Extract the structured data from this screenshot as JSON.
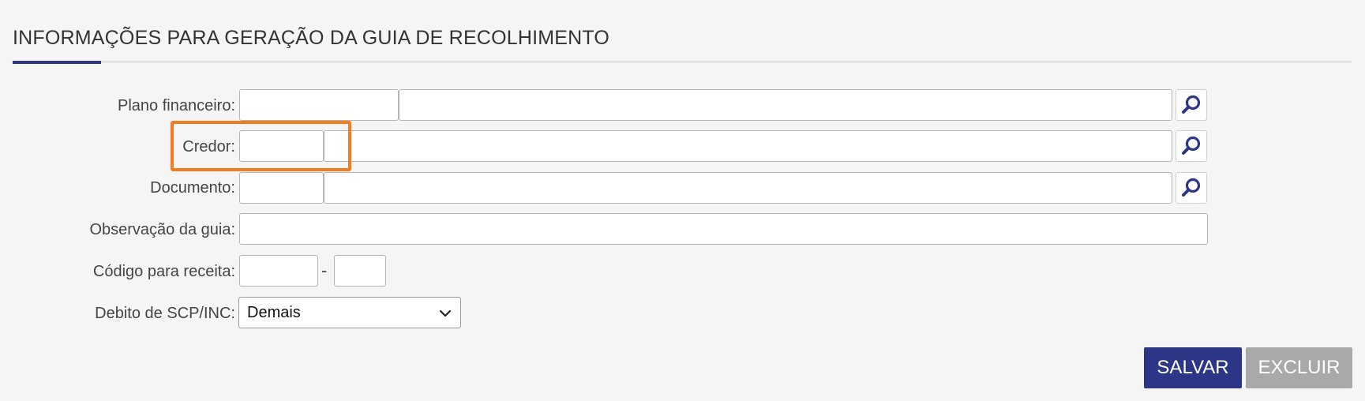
{
  "section": {
    "title": "INFORMAÇÕES PARA GERAÇÃO DA GUIA DE RECOLHIMENTO"
  },
  "fields": {
    "plano_financeiro": {
      "label": "Plano financeiro:",
      "code": "",
      "description": ""
    },
    "credor": {
      "label": "Credor:",
      "code": "",
      "description": ""
    },
    "documento": {
      "label": "Documento:",
      "code": "",
      "description": ""
    },
    "observacao": {
      "label": "Observação da guia:",
      "value": ""
    },
    "codigo_receita": {
      "label": "Código para receita:",
      "part1": "",
      "separator": "-",
      "part2": ""
    },
    "debito": {
      "label": "Debito de SCP/INC:",
      "selected": "Demais"
    }
  },
  "icons": {
    "search": "search-icon",
    "chevron": "chevron-down-icon"
  },
  "buttons": {
    "save": "SALVAR",
    "delete": "EXCLUIR"
  },
  "colors": {
    "primary": "#2c3586",
    "disabled": "#a9a9a9",
    "highlight": "#f47c20",
    "background": "#f5f5f5"
  }
}
